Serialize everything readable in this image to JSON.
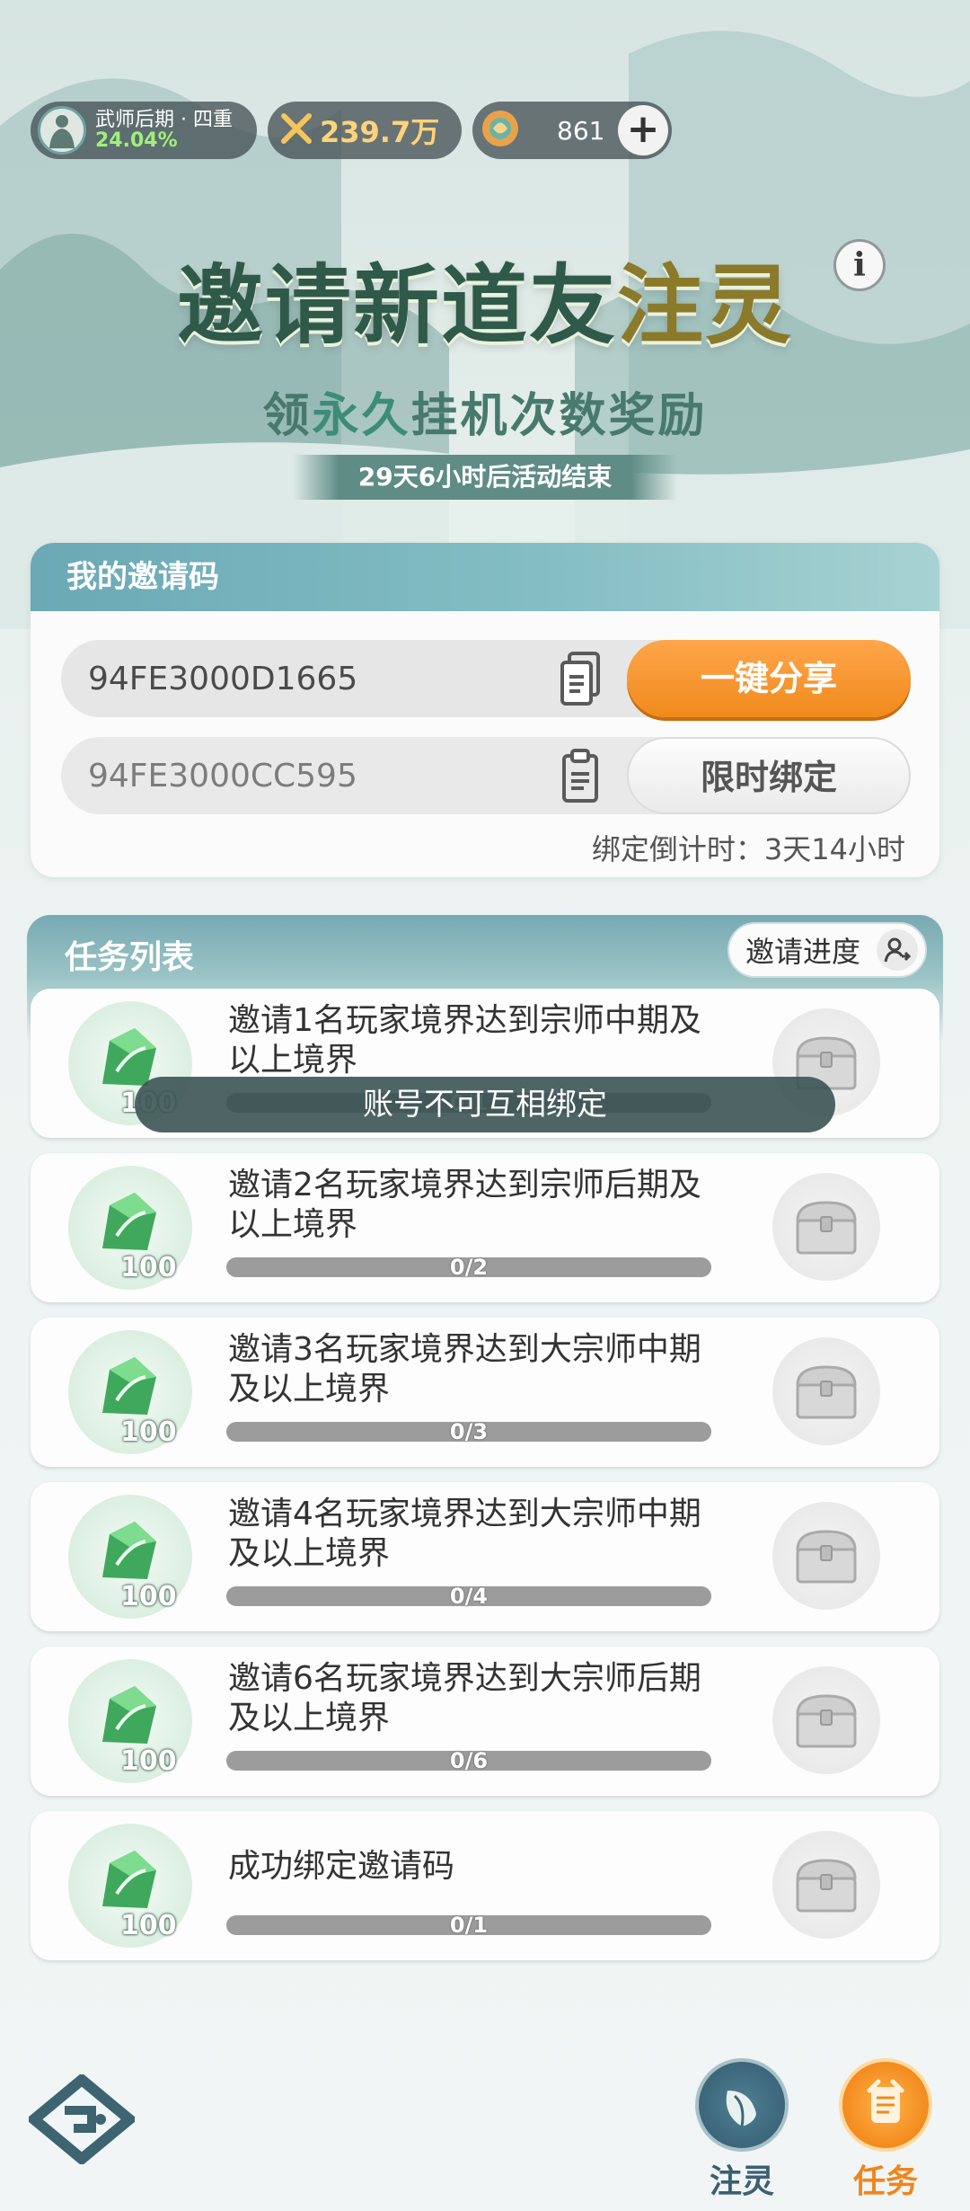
{
  "header": {
    "rank_name": "武师后期 · 四重",
    "rank_progress": "24.04%",
    "power": "239.7万",
    "coins": "861",
    "plus_label": "+"
  },
  "banner": {
    "title_part1": "邀请新道友",
    "title_part2": "注灵",
    "subtitle_part1": "领",
    "subtitle_part2": "永久",
    "subtitle_part3": "挂机次数奖励",
    "countdown": "29天6小时后活动结束",
    "info_label": "i"
  },
  "invite": {
    "title": "我的邀请码",
    "my_code": "94FE3000D1665",
    "share_label": "一键分享",
    "bind_code_placeholder": "94FE3000CC595",
    "bind_label": "限时绑定",
    "bind_countdown": "绑定倒计时：3天14小时"
  },
  "tasks": {
    "title": "任务列表",
    "progress_label": "邀请进度",
    "items": [
      {
        "desc": "邀请1名玩家境界达到宗师中期及以上境界",
        "reward": "100",
        "progress": "0/1",
        "done": 0
      },
      {
        "desc": "邀请2名玩家境界达到宗师后期及以上境界",
        "reward": "100",
        "progress": "0/2",
        "done": 0
      },
      {
        "desc": "邀请3名玩家境界达到大宗师中期及以上境界",
        "reward": "100",
        "progress": "0/3",
        "done": 0
      },
      {
        "desc": "邀请4名玩家境界达到大宗师中期及以上境界",
        "reward": "100",
        "progress": "0/4",
        "done": 0
      },
      {
        "desc": "邀请6名玩家境界达到大宗师后期及以上境界",
        "reward": "100",
        "progress": "0/6",
        "done": 0
      },
      {
        "desc": "成功绑定邀请码",
        "reward": "100",
        "progress": "0/1",
        "done": 0
      }
    ]
  },
  "toast": "账号不可互相绑定",
  "nav": {
    "zhuling": "注灵",
    "task": "任务"
  },
  "colors": {
    "accent_orange": "#f08a1c",
    "header_teal": "#6aa9b5",
    "progress_green": "#9ef07a"
  }
}
